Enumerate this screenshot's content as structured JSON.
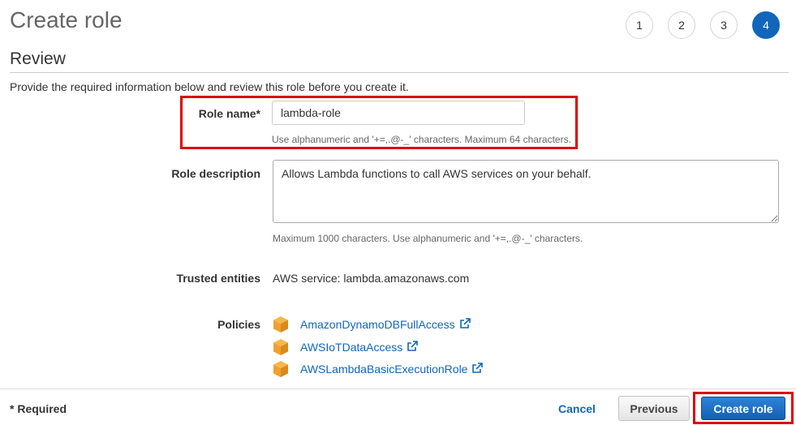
{
  "header": {
    "title": "Create role",
    "steps": [
      "1",
      "2",
      "3",
      "4"
    ],
    "active_step": "4"
  },
  "review": {
    "section_title": "Review",
    "intro": "Provide the required information below and review this role before you create it."
  },
  "form": {
    "role_name": {
      "label": "Role name*",
      "value": "lambda-role",
      "hint": "Use alphanumeric and '+=,.@-_' characters. Maximum 64 characters."
    },
    "role_description": {
      "label": "Role description",
      "value": "Allows Lambda functions to call AWS services on your behalf.",
      "hint": "Maximum 1000 characters. Use alphanumeric and '+=,.@-_' characters."
    },
    "trusted_entities": {
      "label": "Trusted entities",
      "value": "AWS service: lambda.amazonaws.com"
    },
    "policies": {
      "label": "Policies",
      "items": [
        {
          "name": "AmazonDynamoDBFullAccess",
          "icon": "aws-policy-cube-icon"
        },
        {
          "name": "AWSIoTDataAccess",
          "icon": "aws-policy-cube-icon"
        },
        {
          "name": "AWSLambdaBasicExecutionRole",
          "icon": "aws-policy-cube-icon"
        }
      ]
    }
  },
  "footer": {
    "required_note": "* Required",
    "cancel_label": "Cancel",
    "previous_label": "Previous",
    "create_label": "Create role"
  },
  "colors": {
    "accent": "#1166bb",
    "highlight": "#dd0000",
    "policy_icon": "#f0a030"
  }
}
